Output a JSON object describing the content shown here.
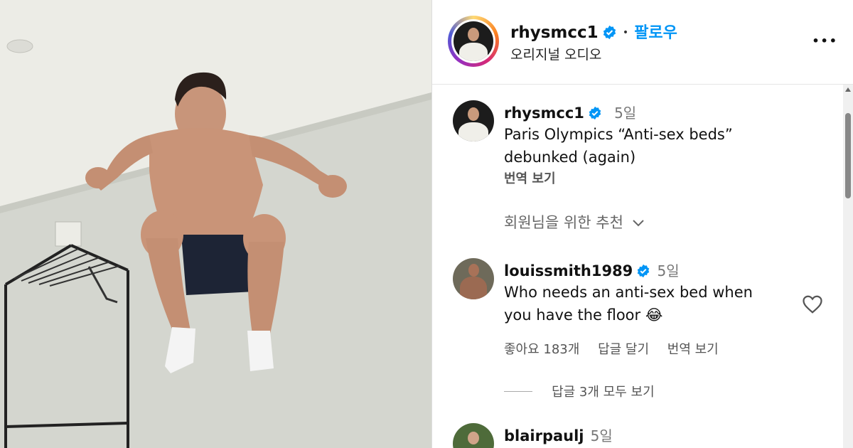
{
  "post": {
    "username": "rhysmcc1",
    "follow_label": "팔로우",
    "dot": "•",
    "audio_label": "오리지널 오디오",
    "more_icon": "more-options-icon",
    "more_glyph": "•••"
  },
  "caption": {
    "username": "rhysmcc1",
    "time": "5일",
    "text_line1": "Paris Olympics “Anti-sex beds”",
    "text_line2": "debunked (again)",
    "translate_label": "번역 보기"
  },
  "recommended_label": "회원님을 위한 추천",
  "comments": [
    {
      "username": "louissmith1989",
      "time": "5일",
      "text_line1": "Who needs an anti-sex bed when",
      "text_line2": "you have the floor 😂",
      "likes_label": "좋아요 183개",
      "reply_label": "답글 달기",
      "translate_label": "번역 보기",
      "view_replies_label": "답글 3개 모두 보기"
    },
    {
      "username": "blairpaulj",
      "time": "5일"
    }
  ],
  "colors": {
    "accent": "#0095f6",
    "verified": "#0095f6"
  }
}
